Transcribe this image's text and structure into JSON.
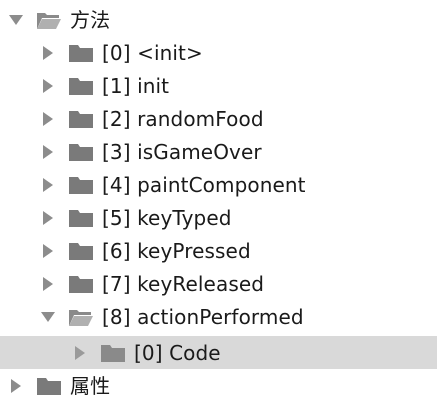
{
  "tree": {
    "root_methods": {
      "label": "方法",
      "expanded": true
    },
    "methods": [
      {
        "label": "[0] <init>",
        "expanded": false
      },
      {
        "label": "[1] init",
        "expanded": false
      },
      {
        "label": "[2] randomFood",
        "expanded": false
      },
      {
        "label": "[3] isGameOver",
        "expanded": false
      },
      {
        "label": "[4] paintComponent",
        "expanded": false
      },
      {
        "label": "[5] keyTyped",
        "expanded": false
      },
      {
        "label": "[6] keyPressed",
        "expanded": false
      },
      {
        "label": "[7] keyReleased",
        "expanded": false
      },
      {
        "label": "[8] actionPerformed",
        "expanded": true
      }
    ],
    "action_children": [
      {
        "label": "[0] Code",
        "selected": true
      }
    ],
    "root_attributes": {
      "label": "属性",
      "expanded": false
    }
  },
  "icons": {
    "arrow_right": "triangle-right-icon",
    "arrow_down": "triangle-down-icon",
    "folder_closed": "folder-icon",
    "folder_open": "folder-open-icon"
  },
  "colors": {
    "arrow": "#8c8c8c",
    "folder": "#7a7a7a",
    "folder_light": "#a6a6a6",
    "selected_bg": "#d9d9d9"
  }
}
